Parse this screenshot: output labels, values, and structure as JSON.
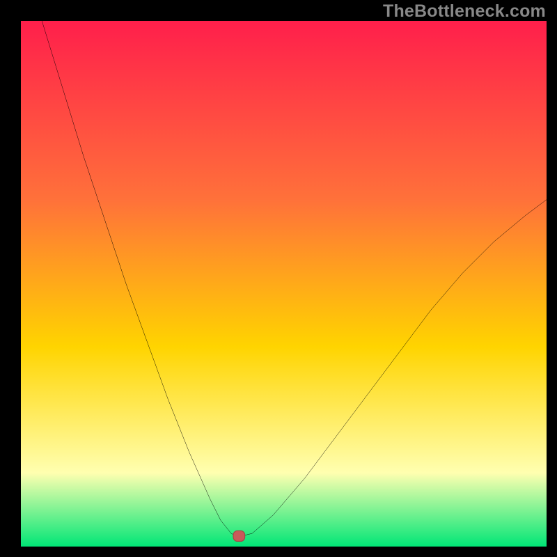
{
  "watermark": "TheBottleneck.com",
  "colors": {
    "page_bg": "#000000",
    "gradient_top": "#ff1f4b",
    "gradient_mid_upper": "#ff713a",
    "gradient_mid": "#ffd400",
    "gradient_mid_lower": "#ffffb0",
    "gradient_bottom": "#00e676",
    "curve_stroke": "#000000",
    "marker_fill": "#c95a5a",
    "marker_stroke": "#a54444"
  },
  "chart_data": {
    "type": "line",
    "title": "",
    "xlabel": "",
    "ylabel": "",
    "xlim": [
      0,
      100
    ],
    "ylim": [
      0,
      100
    ],
    "legend": false,
    "grid": false,
    "series": [
      {
        "name": "bottleneck-curve",
        "x": [
          0,
          4,
          8,
          12,
          16,
          20,
          24,
          28,
          32,
          36,
          38,
          40,
          41,
          42,
          44,
          48,
          54,
          60,
          66,
          72,
          78,
          84,
          90,
          96,
          100
        ],
        "y": [
          111,
          100,
          87,
          74,
          62,
          50,
          39,
          28,
          18,
          9,
          5,
          2.5,
          2,
          2,
          2.5,
          6,
          13,
          21,
          29,
          37,
          45,
          52,
          58,
          63,
          66
        ]
      }
    ],
    "marker": {
      "x": 41.5,
      "y": 2,
      "width": 2.2,
      "height": 2.0
    },
    "annotations": []
  }
}
